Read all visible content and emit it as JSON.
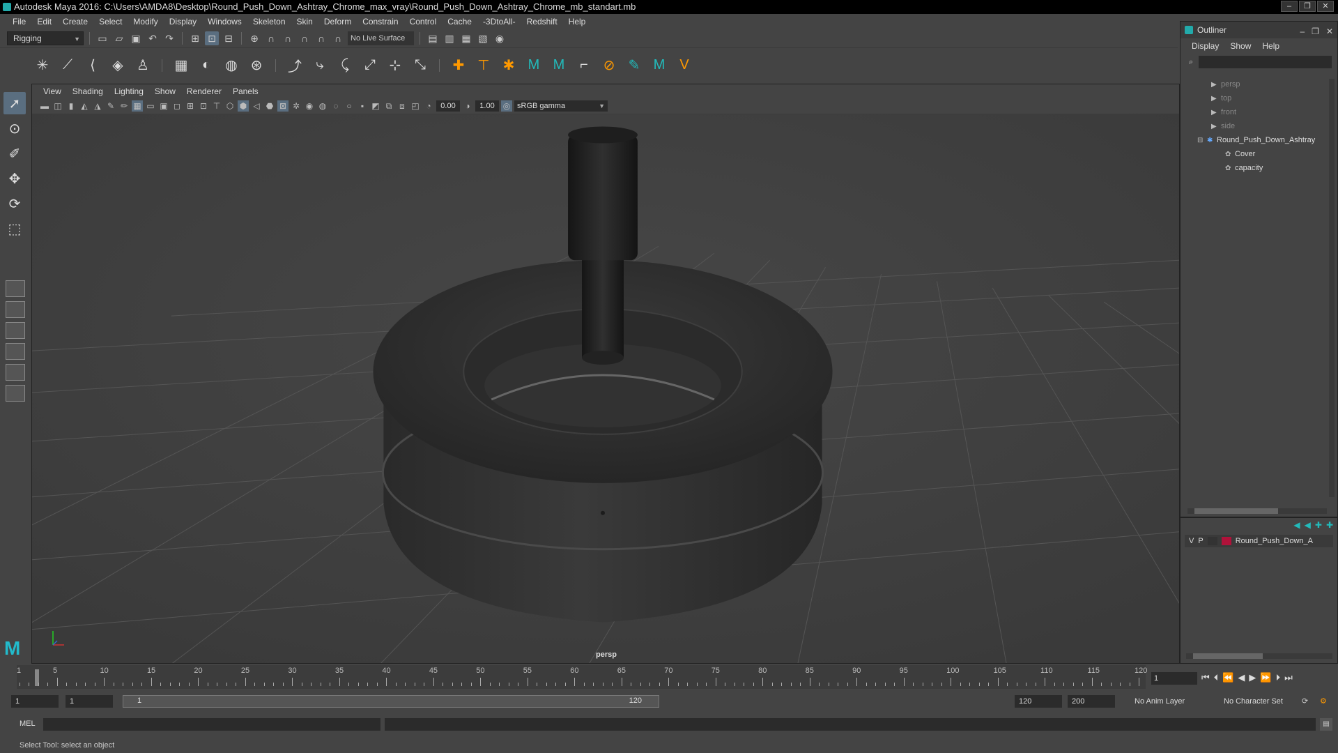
{
  "window": {
    "title": "Autodesk Maya 2016: C:\\Users\\AMDA8\\Desktop\\Round_Push_Down_Ashtray_Chrome_max_vray\\Round_Push_Down_Ashtray_Chrome_mb_standart.mb",
    "minimize": "–",
    "restore": "❐",
    "close": "✕"
  },
  "menubar": [
    "File",
    "Edit",
    "Create",
    "Select",
    "Modify",
    "Display",
    "Windows",
    "Skeleton",
    "Skin",
    "Deform",
    "Constrain",
    "Control",
    "Cache",
    "-3DtoAll-",
    "Redshift",
    "Help"
  ],
  "status_line": {
    "mode": "Rigging",
    "live_surface": "No Live Surface"
  },
  "viewport": {
    "menus": [
      "View",
      "Shading",
      "Lighting",
      "Show",
      "Renderer",
      "Panels"
    ],
    "exposure": "0.00",
    "gamma": "1.00",
    "color_space": "sRGB gamma",
    "camera_label": "persp"
  },
  "outliner": {
    "title": "Outliner",
    "menus": [
      "Display",
      "Show",
      "Help"
    ],
    "items": [
      {
        "label": "persp",
        "dim": true,
        "indent": 1,
        "icon": "camera-icon"
      },
      {
        "label": "top",
        "dim": true,
        "indent": 1,
        "icon": "camera-icon"
      },
      {
        "label": "front",
        "dim": true,
        "indent": 1,
        "icon": "camera-icon"
      },
      {
        "label": "side",
        "dim": true,
        "indent": 1,
        "icon": "camera-icon"
      },
      {
        "label": "Round_Push_Down_Ashtray",
        "dim": false,
        "indent": 0,
        "icon": "group-icon"
      },
      {
        "label": "Cover",
        "dim": false,
        "indent": 2,
        "icon": "mesh-icon"
      },
      {
        "label": "capacity",
        "dim": false,
        "indent": 2,
        "icon": "mesh-icon"
      }
    ]
  },
  "layers": {
    "row": {
      "v": "V",
      "p": "P",
      "name": "Round_Push_Down_A",
      "color": "#b0123a"
    }
  },
  "timeline": {
    "ticks": [
      5,
      10,
      15,
      20,
      25,
      30,
      35,
      40,
      45,
      50,
      55,
      60,
      65,
      70,
      75,
      80,
      85,
      90,
      95,
      100,
      105,
      110,
      115,
      120
    ],
    "start_label": "1",
    "current_frame": "1"
  },
  "range": {
    "start": "1",
    "playback_start": "1",
    "slider_start": "1",
    "slider_end": "120",
    "playback_end": "120",
    "end": "200",
    "anim_layer": "No Anim Layer",
    "character_set": "No Character Set"
  },
  "command_line": {
    "label": "MEL"
  },
  "help_line": "Select Tool: select an object"
}
